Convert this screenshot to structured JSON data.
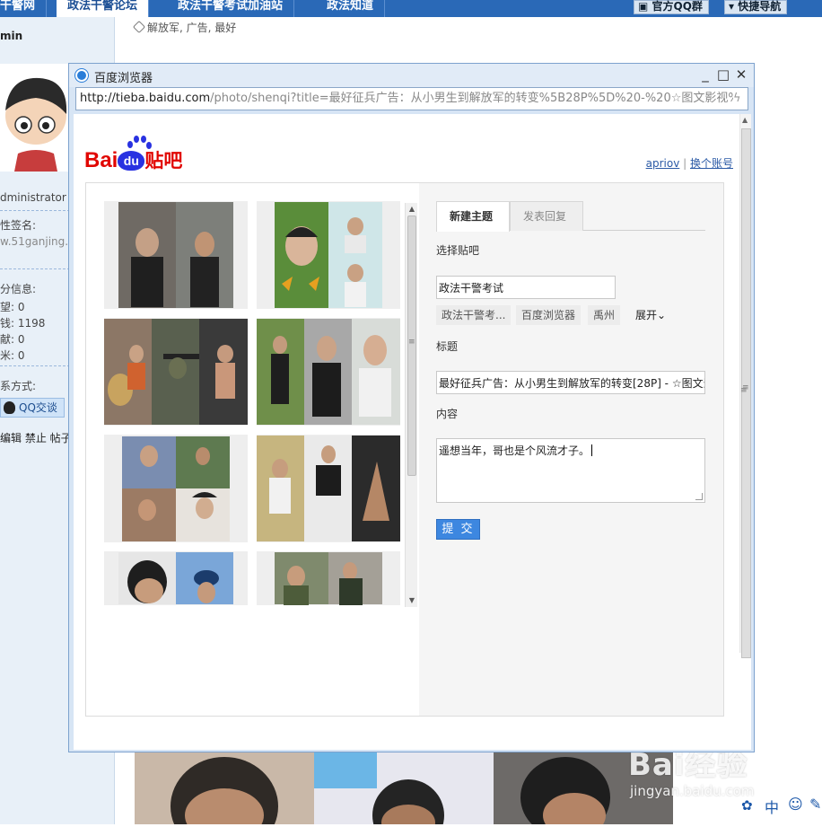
{
  "background_page": {
    "nav_tabs": [
      "干警网",
      "政法干警论坛",
      "政法干警考试加油站",
      "政法知道"
    ],
    "nav_buttons": [
      "官方QQ群",
      "快捷导航"
    ],
    "username": "min",
    "role": "dministrator",
    "signature_label": "性签名:",
    "signature_value": "w.51ganjing.c",
    "points_label": "分信息:",
    "stats": [
      {
        "label": "望:",
        "value": "0"
      },
      {
        "label": "钱:",
        "value": "1198"
      },
      {
        "label": "献:",
        "value": "0"
      },
      {
        "label": "米:",
        "value": "0"
      }
    ],
    "contact_label": "系方式:",
    "qq_button": "QQ交谈",
    "admin_actions": "编辑 禁止 帖子",
    "tags": "解放军, 广告, 最好",
    "bottom_icons": [
      "中"
    ]
  },
  "popup": {
    "window_title": "百度浏览器",
    "url_host": "http://tieba.baidu.com",
    "url_rest": "/photo/shenqi?title=最好征兵广告：从小男生到解放军的转变%5B28P%5D%20-%20☆图文影视%2",
    "account_name": "apriov",
    "switch_account": "换个账号",
    "logo_text_bai": "Bai",
    "logo_text_du": "du",
    "logo_text_tieba": "贴吧",
    "tabs": [
      "新建主题",
      "发表回复"
    ],
    "select_bar_label": "选择贴吧",
    "bar_value": "政法干警考试",
    "suggested_bars": [
      "政法干警考...",
      "百度浏览器",
      "禹州"
    ],
    "expand_label": "展开",
    "title_label": "标题",
    "title_value": "最好征兵广告：从小男生到解放军的转变[28P] - ☆图文影视%2",
    "content_label": "内容",
    "content_value": "遥想当年，哥也是个风流才子。",
    "submit_label": "提 交"
  },
  "watermark": {
    "brand": "Bai经验",
    "url": "jingyan.baidu.com"
  },
  "colors": {
    "nav_blue": "#2a69b7",
    "submit_blue": "#3d87e0",
    "baidu_red": "#e10601",
    "baidu_blue": "#2932e1"
  }
}
